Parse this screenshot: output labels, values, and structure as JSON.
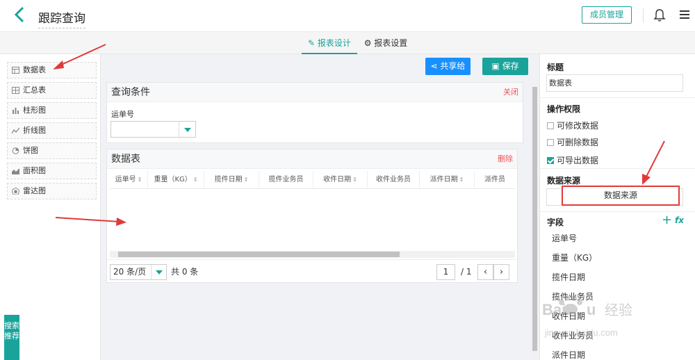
{
  "header": {
    "title": "跟踪查询",
    "member_button": "成员管理"
  },
  "tabs": {
    "design": "报表设计",
    "settings": "报表设置"
  },
  "components": [
    {
      "label": "数据表",
      "icon": "table-icon"
    },
    {
      "label": "汇总表",
      "icon": "summary-table-icon"
    },
    {
      "label": "柱形图",
      "icon": "bar-chart-icon"
    },
    {
      "label": "折线图",
      "icon": "line-chart-icon"
    },
    {
      "label": "饼图",
      "icon": "pie-chart-icon"
    },
    {
      "label": "面积图",
      "icon": "area-chart-icon"
    },
    {
      "label": "雷达图",
      "icon": "radar-chart-icon"
    }
  ],
  "side_tab": "搜索推荐",
  "toolbar": {
    "share": "共享给",
    "save": "保存"
  },
  "query": {
    "title": "查询条件",
    "close": "关闭",
    "field_label": "运单号",
    "field_value": ""
  },
  "table": {
    "title": "数据表",
    "delete": "删除",
    "columns": [
      "运单号",
      "重量（KG）",
      "揽件日期",
      "揽件业务员",
      "收件日期",
      "收件业务员",
      "派件日期",
      "派件员"
    ],
    "page_size": "20 条/页",
    "total": "共 0 条",
    "current_page": "1",
    "page_total": "/ 1"
  },
  "right": {
    "title_label": "标题",
    "title_value": "数据表",
    "perm_label": "操作权限",
    "perms": [
      {
        "label": "可修改数据",
        "checked": false
      },
      {
        "label": "可删除数据",
        "checked": false
      },
      {
        "label": "可导出数据",
        "checked": true
      }
    ],
    "source_label": "数据来源",
    "source_button": "数据来源",
    "fields_label": "字段",
    "fields": [
      "运单号",
      "重量（KG）",
      "揽件日期",
      "揽件业务员",
      "收件日期",
      "收件业务员",
      "派件日期"
    ]
  },
  "colors": {
    "accent": "#1aa39a",
    "primary": "#1890ff",
    "danger": "#e03a3a"
  }
}
